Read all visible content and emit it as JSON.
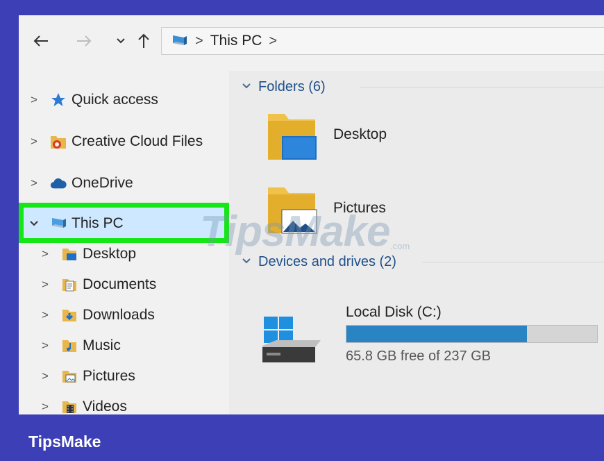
{
  "address_bar": {
    "crumbs": [
      "This PC"
    ],
    "back_icon": "arrow-left-icon",
    "forward_icon": "arrow-right-icon",
    "recent_icon": "chevron-down-icon",
    "up_icon": "arrow-up-icon"
  },
  "sidebar": {
    "items": [
      {
        "label": "Quick access",
        "icon": "star-icon"
      },
      {
        "label": "Creative Cloud Files",
        "icon": "creative-cloud-folder-icon"
      },
      {
        "label": "OneDrive",
        "icon": "cloud-icon"
      },
      {
        "label": "This PC",
        "icon": "computer-icon",
        "expanded": true,
        "selected": true
      },
      {
        "label": "Desktop",
        "icon": "desktop-folder-icon"
      },
      {
        "label": "Documents",
        "icon": "documents-folder-icon"
      },
      {
        "label": "Downloads",
        "icon": "downloads-folder-icon"
      },
      {
        "label": "Music",
        "icon": "music-folder-icon"
      },
      {
        "label": "Pictures",
        "icon": "pictures-folder-icon"
      },
      {
        "label": "Videos",
        "icon": "videos-folder-icon"
      }
    ]
  },
  "main": {
    "folders_header": "Folders (6)",
    "folders": [
      {
        "label": "Desktop"
      },
      {
        "label": "Pictures"
      }
    ],
    "devices_header": "Devices and drives (2)",
    "drive": {
      "name": "Local Disk (C:)",
      "free_text": "65.8 GB free of 237 GB",
      "used_fraction": 0.72
    }
  },
  "watermark": {
    "text": "TipsMake",
    "suffix": ".com"
  },
  "footer": {
    "brand": "TipsMake"
  },
  "colors": {
    "frame": "#3c3fb5",
    "highlight_border": "#15e615",
    "selected_bg": "#cde8ff",
    "drive_fill": "#2a84c4",
    "group_header": "#1e4f8a"
  }
}
